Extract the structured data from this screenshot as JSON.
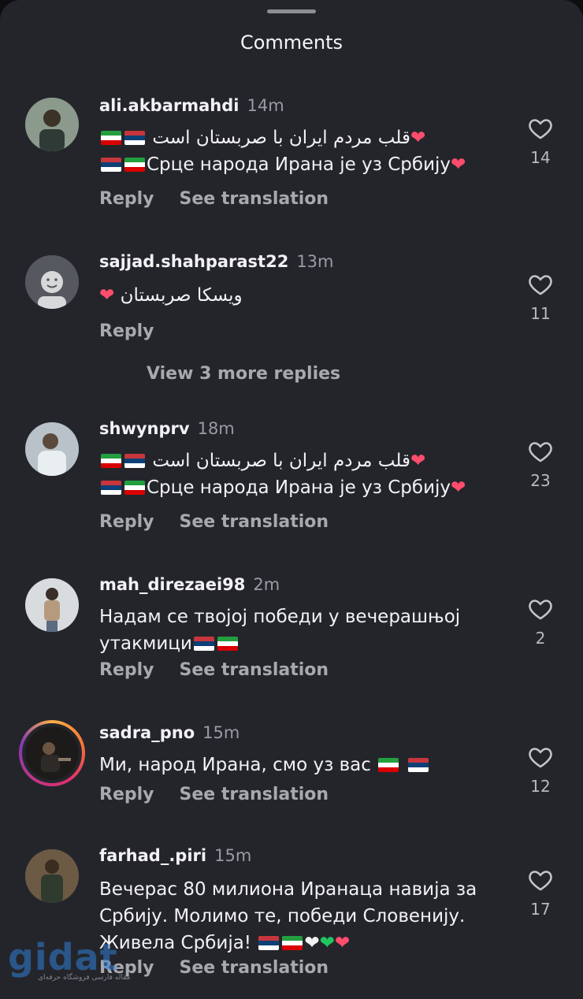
{
  "sheet": {
    "title": "Comments"
  },
  "labels": {
    "reply": "Reply",
    "see_translation": "See translation",
    "view_more": "View 3 more replies"
  },
  "comments": [
    {
      "username": "ali.akbarmahdi",
      "time": "14m",
      "lines": [
        "قلب مردم ایران با صربستان است",
        "Срце народа Ирана је уз Србију"
      ],
      "likes": "14",
      "has_translation": true
    },
    {
      "username": "sajjad.shahparast22",
      "time": "13m",
      "lines": [
        "ویسکا صربستان"
      ],
      "likes": "11",
      "has_translation": false
    },
    {
      "username": "shwynprv",
      "time": "18m",
      "lines": [
        "قلب مردم ایران با صربستان است",
        "Срце народа Ирана је уз Србију"
      ],
      "likes": "23",
      "has_translation": true
    },
    {
      "username": "mah_direzaei98",
      "time": "2m",
      "lines": [
        "Надам се твојој победи у вечерашњој",
        "утакмици"
      ],
      "likes": "2",
      "has_translation": true
    },
    {
      "username": "sadra_pno",
      "time": "15m",
      "lines": [
        "Ми, народ Ирана, смо уз вас"
      ],
      "likes": "12",
      "has_translation": true
    },
    {
      "username": "farhad_.piri",
      "time": "15m",
      "lines": [
        "Вечерас 80 милиона Иранаца навија за",
        "Србију. Молимо те, победи Словенију.",
        "Живела Србија!"
      ],
      "likes": "17",
      "has_translation": true
    }
  ],
  "watermark": {
    "text": "gidat",
    "sub": "مقاله فارسی فروشگاه حرفه‌ای"
  },
  "icons": {
    "like": "heart-outline-icon"
  },
  "colors": {
    "background": "#24252b",
    "text": "#f2f2f4",
    "muted": "#a8a9ae",
    "emoji_heart": "#ff4d6d"
  }
}
